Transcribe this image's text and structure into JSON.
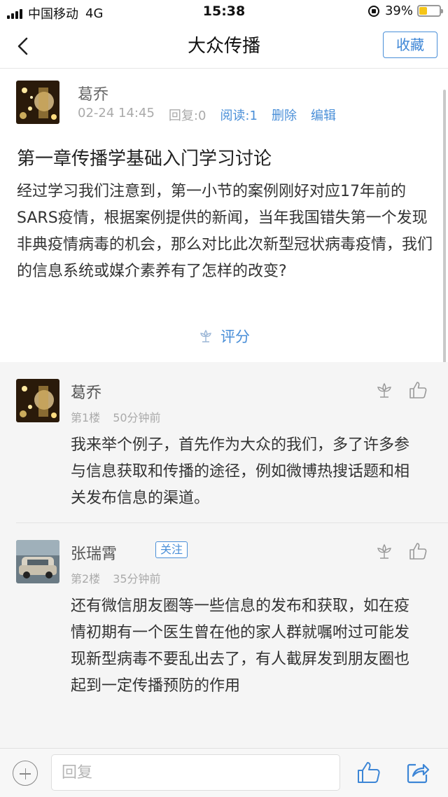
{
  "status_bar": {
    "carrier": "中国移动",
    "network": "4G",
    "time": "15:38",
    "battery": "39%",
    "battery_level": 0.39
  },
  "nav": {
    "title": "大众传播",
    "fav_label": "收藏",
    "back_icon": "chevron-left-icon"
  },
  "post": {
    "author": "葛乔",
    "date": "02-24 14:45",
    "replies": "回复:0",
    "reads": "阅读:1",
    "delete_label": "删除",
    "edit_label": "编辑",
    "title": "第一章传播学基础入门学习讨论",
    "body": "经过学习我们注意到，第一小节的案例刚好对应17年前的SARS疫情，根据案例提供的新闻，当年我国错失第一个发现非典疫情病毒的机会，那么对比此次新型冠状病毒疫情，我们的信息系统或媒介素养有了怎样的改变?",
    "rate_label": "评分"
  },
  "replies": [
    {
      "name": "葛乔",
      "floor": "第1楼",
      "time": "50分钟前",
      "content": "我来举个例子，首先作为大众的我们，多了许多参与信息获取和传播的途径，例如微博热搜话题和相关发布信息的渠道。"
    },
    {
      "name": "张瑞霄",
      "follow_label": "关注",
      "floor": "第2楼",
      "time": "35分钟前",
      "content": "还有微信朋友圈等一些信息的发布和获取，如在疫情初期有一个医生曾在他的家人群就嘱咐过可能发现新型病毒不要乱出去了，有人截屏发到朋友圈也起到一定传播预防的作用"
    }
  ],
  "bottom_bar": {
    "reply_placeholder": "回复"
  },
  "colors": {
    "accent": "#4a8fd8",
    "reply_bg": "#f5f5f5"
  }
}
